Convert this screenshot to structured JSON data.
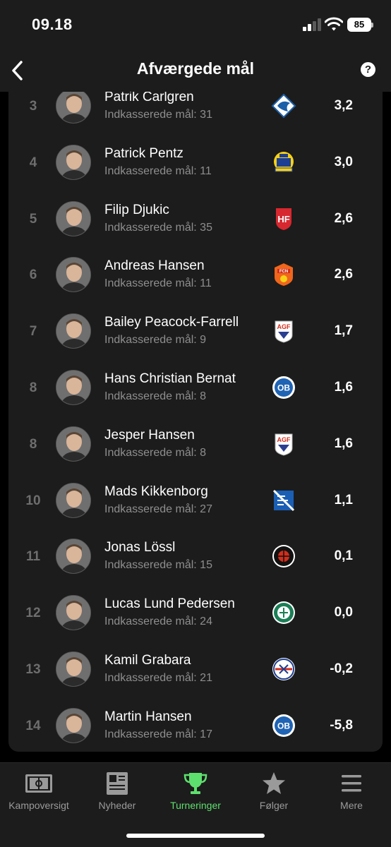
{
  "status_bar": {
    "time": "09.18",
    "battery": "85"
  },
  "header": {
    "title": "Afværgede mål",
    "help_label": "?"
  },
  "players": [
    {
      "rank": "3",
      "name": "Patrik Carlgren",
      "sub": "Indkasserede mål: 31",
      "value": "3,2",
      "club": "randers-fc-logo"
    },
    {
      "rank": "4",
      "name": "Patrick Pentz",
      "sub": "Indkasserede mål: 11",
      "value": "3,0",
      "club": "brondby-if-logo"
    },
    {
      "rank": "5",
      "name": "Filip Djukic",
      "sub": "Indkasserede mål: 35",
      "value": "2,6",
      "club": "hillerod-fodbold-logo"
    },
    {
      "rank": "6",
      "name": "Andreas Hansen",
      "sub": "Indkasserede mål: 11",
      "value": "2,6",
      "club": "fc-nordsjaelland-logo"
    },
    {
      "rank": "7",
      "name": "Bailey Peacock-Farrell",
      "sub": "Indkasserede mål: 9",
      "value": "1,7",
      "club": "agf-logo"
    },
    {
      "rank": "8",
      "name": "Hans Christian Bernat",
      "sub": "Indkasserede mål: 8",
      "value": "1,6",
      "club": "ob-logo"
    },
    {
      "rank": "8",
      "name": "Jesper Hansen",
      "sub": "Indkasserede mål: 8",
      "value": "1,6",
      "club": "agf-logo"
    },
    {
      "rank": "10",
      "name": "Mads Kikkenborg",
      "sub": "Indkasserede mål: 27",
      "value": "1,1",
      "club": "lyngby-bk-logo"
    },
    {
      "rank": "11",
      "name": "Jonas Lössl",
      "sub": "Indkasserede mål: 15",
      "value": "0,1",
      "club": "fc-midtjylland-logo"
    },
    {
      "rank": "12",
      "name": "Lucas Lund Pedersen",
      "sub": "Indkasserede mål: 24",
      "value": "0,0",
      "club": "viborg-ff-logo"
    },
    {
      "rank": "13",
      "name": "Kamil Grabara",
      "sub": "Indkasserede mål: 21",
      "value": "-0,2",
      "club": "fc-kobenhavn-logo"
    },
    {
      "rank": "14",
      "name": "Martin Hansen",
      "sub": "Indkasserede mål: 17",
      "value": "-5,8",
      "club": "ob-logo"
    }
  ],
  "club_logo_text": {
    "ob": "OB",
    "hillerod": "HF",
    "agf": "AGF",
    "nordsjaelland": "FCN"
  },
  "tabs": [
    {
      "label": "Kampoversigt",
      "icon": "pitch-icon",
      "active": false
    },
    {
      "label": "Nyheder",
      "icon": "news-icon",
      "active": false
    },
    {
      "label": "Turneringer",
      "icon": "trophy-icon",
      "active": true
    },
    {
      "label": "Følger",
      "icon": "star-icon",
      "active": false
    },
    {
      "label": "Mere",
      "icon": "menu-icon",
      "active": false
    }
  ],
  "colors": {
    "accent": "#5ee06e",
    "background": "#000000",
    "surface": "#1c1c1c",
    "muted": "#8e8e8e"
  }
}
